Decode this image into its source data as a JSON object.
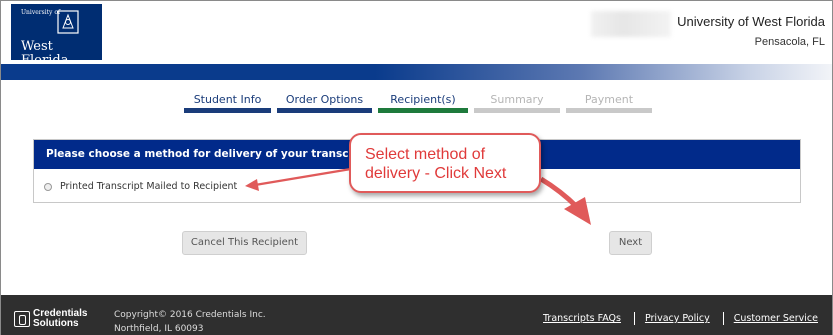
{
  "header": {
    "logo": {
      "line1": "University of",
      "line2": "West Florida",
      "icon": "seal-icon"
    },
    "university_name": "University of West Florida",
    "university_location": "Pensacola, FL"
  },
  "steps": [
    {
      "label": "Student Info",
      "state": "done"
    },
    {
      "label": "Order Options",
      "state": "done"
    },
    {
      "label": "Recipient(s)",
      "state": "active"
    },
    {
      "label": "Summary",
      "state": "todo"
    },
    {
      "label": "Payment",
      "state": "todo"
    }
  ],
  "panel": {
    "heading": "Please choose a method for delivery of your transcript for",
    "option_label": "Printed Transcript Mailed to Recipient"
  },
  "callout": {
    "line1": "Select method of",
    "line2": "delivery - Click Next"
  },
  "buttons": {
    "cancel_label": "Cancel This Recipient",
    "next_label": "Next"
  },
  "footer": {
    "brand_line1": "Credentials",
    "brand_line2": "Solutions",
    "copyright": "Copyright© 2016 Credentials Inc.",
    "address": "Northfield, IL 60093",
    "links": [
      "Transcripts FAQs",
      "Privacy Policy",
      "Customer Service"
    ]
  },
  "colors": {
    "brand_navy": "#002d72",
    "panel_header": "#012a8a",
    "step_done": "#1a3c7a",
    "step_active": "#1e7a3c",
    "callout_red": "#e03a3a"
  }
}
